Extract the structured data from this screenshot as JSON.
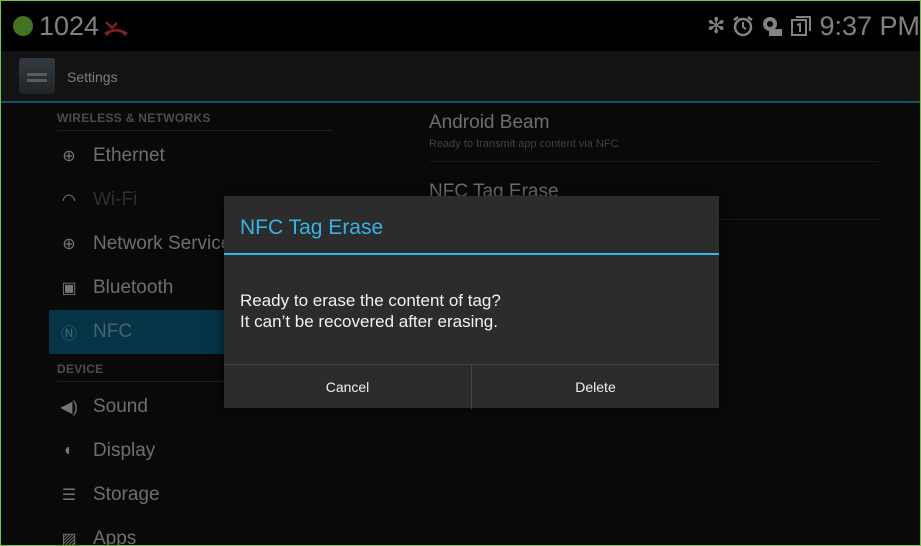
{
  "status_bar": {
    "notification_count": "1024",
    "time": "9:37 PM",
    "icons": [
      "bluetooth-icon",
      "alarm-icon",
      "settings-notification-icon",
      "screenshot-icon"
    ]
  },
  "action_bar": {
    "title": "Settings"
  },
  "sidebar": {
    "wireless_header": "WIRELESS & NETWORKS",
    "device_header": "DEVICE",
    "items": [
      {
        "label": "Ethernet",
        "icon": "ethernet-icon"
      },
      {
        "label": "Wi-Fi",
        "icon": "wifi-icon"
      },
      {
        "label": "Network Service",
        "icon": "network-service-icon"
      },
      {
        "label": "Bluetooth",
        "icon": "bluetooth-icon"
      },
      {
        "label": "NFC",
        "icon": "nfc-icon"
      },
      {
        "label": "Sound",
        "icon": "sound-icon"
      },
      {
        "label": "Display",
        "icon": "display-icon"
      },
      {
        "label": "Storage",
        "icon": "storage-icon"
      },
      {
        "label": "Apps",
        "icon": "apps-icon"
      }
    ]
  },
  "detail": {
    "android_beam_title": "Android Beam",
    "android_beam_sub": "Ready to transmit app content via NFC",
    "nfc_erase_title": "NFC Tag Erase"
  },
  "dialog": {
    "title": "NFC Tag Erase",
    "message_line1": "Ready to erase the content of tag?",
    "message_line2": "It can’t be recovered after erasing.",
    "cancel_label": "Cancel",
    "delete_label": "Delete"
  },
  "colors": {
    "accent": "#33b5e5",
    "selected": "#0c5f82",
    "status_dot": "#7fd03c"
  }
}
